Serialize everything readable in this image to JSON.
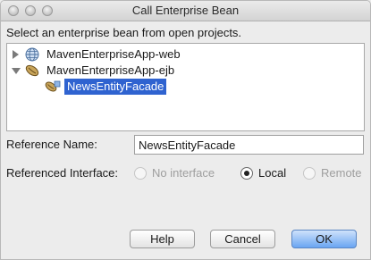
{
  "window": {
    "title": "Call Enterprise Bean"
  },
  "prompt": "Select an enterprise bean from open projects.",
  "tree": {
    "items": [
      {
        "label": "MavenEnterpriseApp-web",
        "expanded": false,
        "icon": "globe-icon"
      },
      {
        "label": "MavenEnterpriseApp-ejb",
        "expanded": true,
        "icon": "bean-icon"
      },
      {
        "label": "NewsEntityFacade",
        "selected": true,
        "icon": "enterprise-bean-icon"
      }
    ]
  },
  "reference_name": {
    "label": "Reference Name:",
    "value": "NewsEntityFacade"
  },
  "referenced_interface": {
    "label": "Referenced Interface:",
    "options": [
      {
        "label": "No interface",
        "enabled": false,
        "checked": false
      },
      {
        "label": "Local",
        "enabled": true,
        "checked": true
      },
      {
        "label": "Remote",
        "enabled": false,
        "checked": false
      }
    ]
  },
  "buttons": {
    "help": "Help",
    "cancel": "Cancel",
    "ok": "OK"
  },
  "colors": {
    "selection": "#2f63d0",
    "window_bg": "#ececec",
    "primary_button": "#6aa5f2"
  }
}
